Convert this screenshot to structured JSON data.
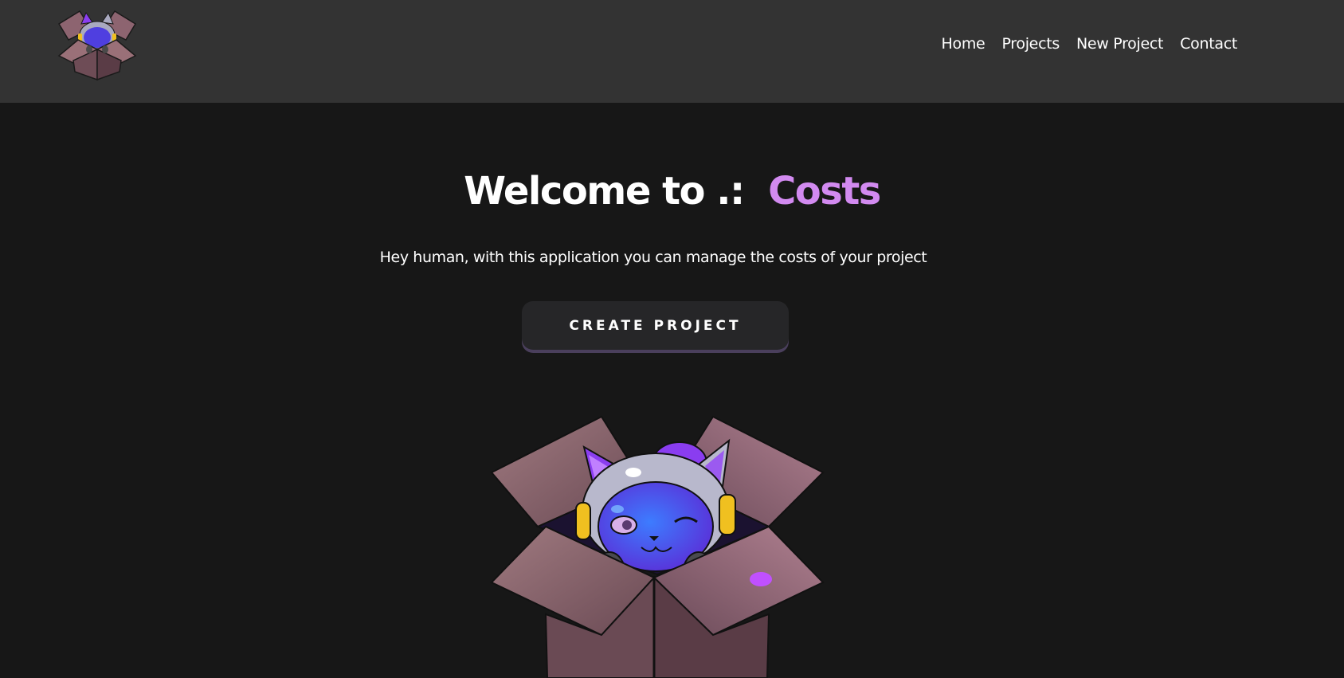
{
  "navbar": {
    "logo_alt": "Costs logo",
    "links": [
      {
        "label": "Home"
      },
      {
        "label": "Projects"
      },
      {
        "label": "New Project"
      },
      {
        "label": "Contact"
      }
    ]
  },
  "hero": {
    "title_prefix": "Welcome to .:",
    "title_accent": "Costs",
    "subtitle": "Hey human, with this application you can manage the costs of your project",
    "cta_label": "Create Project",
    "image_alt": "Cat astronaut in a cardboard box"
  },
  "colors": {
    "navbar_bg": "#333333",
    "page_bg": "#171717",
    "accent": "#d28af0",
    "button_bg": "#262628",
    "button_shadow": "#4a3f5c"
  }
}
